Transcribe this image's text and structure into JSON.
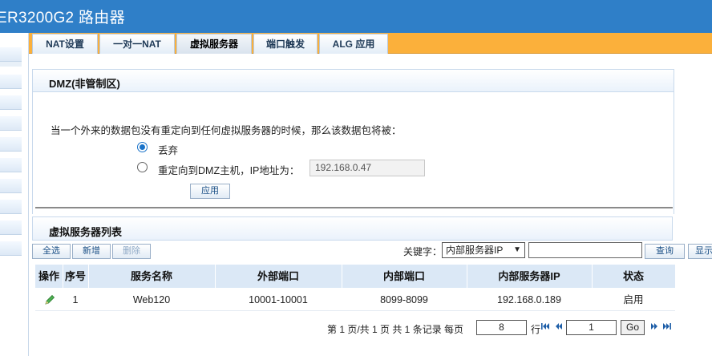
{
  "app": {
    "title": "ER3200G2 路由器"
  },
  "tabs": [
    {
      "label": "NAT设置"
    },
    {
      "label": "一对一NAT"
    },
    {
      "label": "虚拟服务器",
      "active": true
    },
    {
      "label": "端口触发"
    },
    {
      "label": "ALG 应用"
    }
  ],
  "dmz": {
    "title": "DMZ(非管制区)",
    "description": "当一个外来的数据包没有重定向到任何虚拟服务器的时候，那么该数据包将被：",
    "option_drop": "丢弃",
    "option_redirect": "重定向到DMZ主机，IP地址为：",
    "selected": "drop",
    "ip_value": "192.168.0.47",
    "apply_label": "应用"
  },
  "list": {
    "title": "虚拟服务器列表",
    "select_all": "全选",
    "add": "新增",
    "delete": "删除",
    "keyword_label": "关键字：",
    "keyword_option": "内部服务器IP",
    "keyword_value": "",
    "query": "查询",
    "show": "显示",
    "columns": [
      "操作",
      "序号",
      "服务名称",
      "外部端口",
      "内部端口",
      "内部服务器IP",
      "状态"
    ],
    "rows": [
      {
        "index": "1",
        "name": "Web120",
        "ext_port": "10001-10001",
        "int_port": "8099-8099",
        "ip": "192.168.0.189",
        "status": "启用"
      }
    ]
  },
  "pagination": {
    "summary": "第 1 页/共 1 页 共 1 条记录 每页",
    "per_page": "8",
    "row_unit": "行",
    "page": "1",
    "go": "Go"
  },
  "colors": {
    "header": "#2f7fc8",
    "tabbar": "#fbb03b",
    "table_head": "#dbe8f6"
  }
}
